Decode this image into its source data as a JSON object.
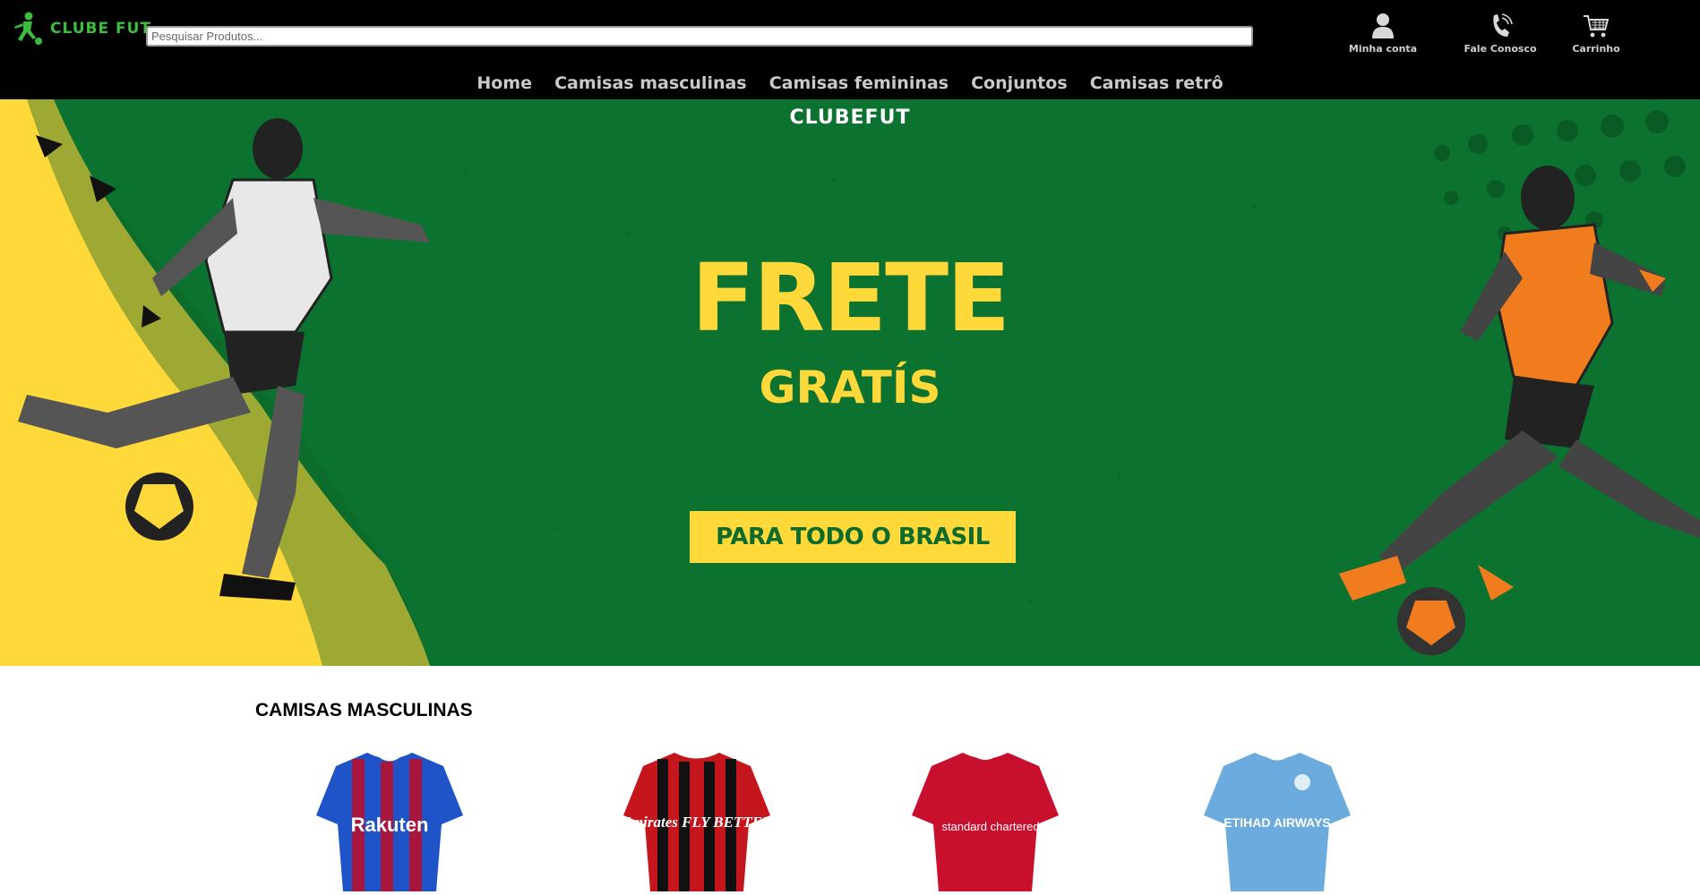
{
  "brand": {
    "logo_text": "CLUBE FUT",
    "accent": "#3dbd3d"
  },
  "search": {
    "placeholder": "Pesquisar Produtos...",
    "value": ""
  },
  "header_actions": [
    {
      "label": "Minha conta",
      "icon": "user-icon"
    },
    {
      "label": "Fale Conosco",
      "icon": "phone-icon"
    },
    {
      "label": "Carrinho",
      "icon": "cart-icon"
    }
  ],
  "nav": {
    "items": [
      "Home",
      "Camisas masculinas",
      "Camisas femininas",
      "Conjuntos",
      "Camisas retrô"
    ]
  },
  "hero": {
    "brand": "CLUBEFUT",
    "headline": "FRETE",
    "subheadline": "GRATÍS",
    "cta": "PARA TODO O BRASIL",
    "colors": {
      "green": "#0c7230",
      "yellow": "#ffd83a"
    }
  },
  "products": {
    "section_title": "CAMISAS MASCULINAS",
    "items": [
      {
        "name": "barcelona-jersey",
        "sponsor": "Rakuten",
        "colors": [
          "#1f54c9",
          "#a8163d"
        ]
      },
      {
        "name": "milan-jersey",
        "sponsor": "Emirates FLY BETTER",
        "colors": [
          "#c4161c",
          "#111111"
        ]
      },
      {
        "name": "liverpool-jersey",
        "sponsor": "standard chartered",
        "colors": [
          "#c8102e",
          "#c8102e"
        ]
      },
      {
        "name": "manchester-city-jersey",
        "sponsor": "ETIHAD AIRWAYS",
        "colors": [
          "#6cabdd",
          "#6cabdd"
        ]
      }
    ]
  }
}
